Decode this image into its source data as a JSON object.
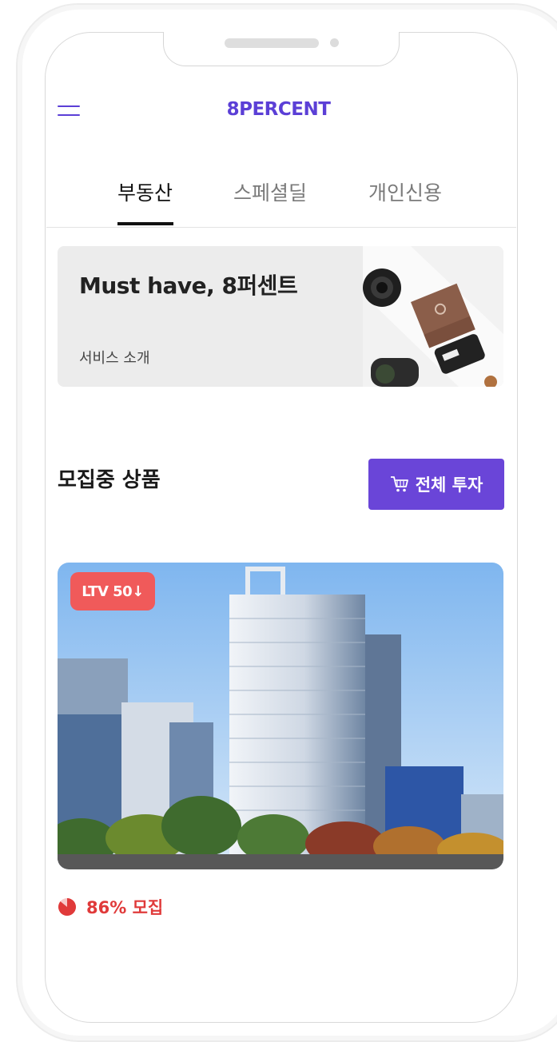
{
  "header": {
    "logo": "8PERCENT"
  },
  "tabs": [
    {
      "label": "부동산",
      "active": true
    },
    {
      "label": "스페셜딜",
      "active": false
    },
    {
      "label": "개인신용",
      "active": false
    }
  ],
  "banner": {
    "title": "Must have, 8퍼센트",
    "subtitle": "서비스 소개"
  },
  "section": {
    "title": "모집중 상품",
    "invest_all_label": "전체 투자"
  },
  "product": {
    "badge": "LTV 50↓",
    "progress_text": "86% 모집",
    "progress_percent": 86
  },
  "colors": {
    "brand": "#5b3fd6",
    "button": "#6a45d8",
    "badge": "#f05a5a",
    "progress": "#e03a3a"
  },
  "icons": {
    "menu": "hamburger-icon",
    "cart": "cart-icon",
    "progress": "pie-progress-icon"
  }
}
